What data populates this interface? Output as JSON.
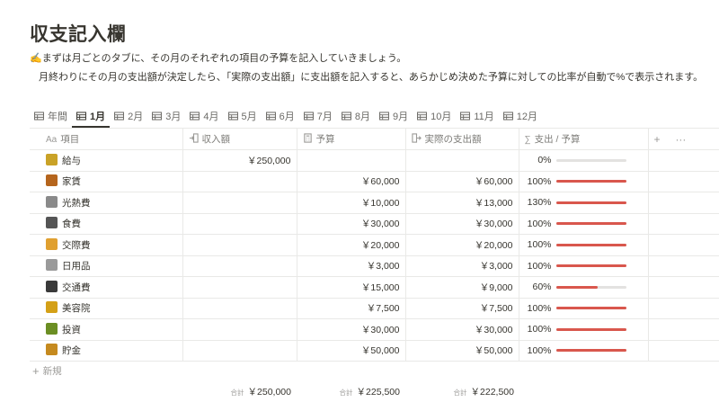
{
  "page": {
    "title": "収支記入欄",
    "description_line1": "✍️まずは月ごとのタブに、その月のそれぞれの項目の予算を記入していきましょう。",
    "description_line2": "月終わりにその月の支出額が決定したら、「実際の支出額」に支出額を記入すると、あらかじめ決めた予算に対しての比率が自動で%で表示されます。"
  },
  "tabs": [
    {
      "label": "年間",
      "active": false
    },
    {
      "label": "1月",
      "active": true
    },
    {
      "label": "2月",
      "active": false
    },
    {
      "label": "3月",
      "active": false
    },
    {
      "label": "4月",
      "active": false
    },
    {
      "label": "5月",
      "active": false
    },
    {
      "label": "6月",
      "active": false
    },
    {
      "label": "7月",
      "active": false
    },
    {
      "label": "8月",
      "active": false
    },
    {
      "label": "9月",
      "active": false
    },
    {
      "label": "10月",
      "active": false
    },
    {
      "label": "11月",
      "active": false
    },
    {
      "label": "12月",
      "active": false
    }
  ],
  "columns": {
    "name": "項目",
    "name_prefix": "Aa",
    "income": "収入額",
    "budget": "予算",
    "actual": "実際の支出額",
    "ratio": "支出 / 予算",
    "add": "+",
    "more": "···"
  },
  "rows": [
    {
      "name": "給与",
      "icon": "money-bag-icon",
      "color": "#c9a227",
      "income": "￥250,000",
      "budget": "",
      "actual": "",
      "ratio": "0%",
      "ratio_value": 0
    },
    {
      "name": "家賃",
      "icon": "house-icon",
      "color": "#b5651d",
      "income": "",
      "budget": "￥60,000",
      "actual": "￥60,000",
      "ratio": "100%",
      "ratio_value": 100
    },
    {
      "name": "光熱費",
      "icon": "bulb-icon",
      "color": "#8a8a8a",
      "income": "",
      "budget": "￥10,000",
      "actual": "￥13,000",
      "ratio": "130%",
      "ratio_value": 130
    },
    {
      "name": "食費",
      "icon": "rice-icon",
      "color": "#555555",
      "income": "",
      "budget": "￥30,000",
      "actual": "￥30,000",
      "ratio": "100%",
      "ratio_value": 100
    },
    {
      "name": "交際費",
      "icon": "handshake-icon",
      "color": "#e0a030",
      "income": "",
      "budget": "￥20,000",
      "actual": "￥20,000",
      "ratio": "100%",
      "ratio_value": 100
    },
    {
      "name": "日用品",
      "icon": "tissue-icon",
      "color": "#9a9a9a",
      "income": "",
      "budget": "￥3,000",
      "actual": "￥3,000",
      "ratio": "100%",
      "ratio_value": 100
    },
    {
      "name": "交通費",
      "icon": "train-icon",
      "color": "#3a3a3a",
      "income": "",
      "budget": "￥15,000",
      "actual": "￥9,000",
      "ratio": "60%",
      "ratio_value": 60
    },
    {
      "name": "美容院",
      "icon": "haircut-icon",
      "color": "#d4a017",
      "income": "",
      "budget": "￥7,500",
      "actual": "￥7,500",
      "ratio": "100%",
      "ratio_value": 100
    },
    {
      "name": "投資",
      "icon": "money-wings-icon",
      "color": "#6b8e23",
      "income": "",
      "budget": "￥30,000",
      "actual": "￥30,000",
      "ratio": "100%",
      "ratio_value": 100
    },
    {
      "name": "貯金",
      "icon": "piggy-bag-icon",
      "color": "#c58a1f",
      "income": "",
      "budget": "￥50,000",
      "actual": "￥50,000",
      "ratio": "100%",
      "ratio_value": 100
    }
  ],
  "new_row_label": "新規",
  "totals": {
    "label": "合計",
    "income": "￥250,000",
    "budget": "￥225,500",
    "actual": "￥222,500"
  },
  "colors": {
    "bar_fill": "#d9574d",
    "bar_track": "#e3e2e0",
    "text": "#37352f",
    "muted": "#9b9a97",
    "border": "#e9e9e7"
  }
}
